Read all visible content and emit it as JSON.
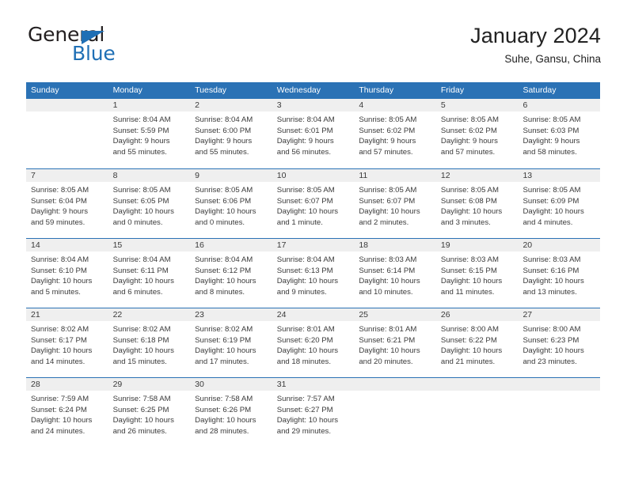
{
  "brand": {
    "name_top": "General",
    "name_bottom": "Blue",
    "triangle_color": "#1f6fb5",
    "top_color": "#231f20"
  },
  "header": {
    "title": "January 2024",
    "subtitle": "Suhe, Gansu, China"
  },
  "colors": {
    "header_bar": "#2b72b5",
    "day_strip": "#efefef",
    "text": "#3a3a3a",
    "header_text": "#ffffff"
  },
  "weekdays": [
    "Sunday",
    "Monday",
    "Tuesday",
    "Wednesday",
    "Thursday",
    "Friday",
    "Saturday"
  ],
  "weeks": [
    [
      {
        "day": "",
        "empty": true
      },
      {
        "day": "1",
        "sunrise": "Sunrise: 8:04 AM",
        "sunset": "Sunset: 5:59 PM",
        "daylight1": "Daylight: 9 hours",
        "daylight2": "and 55 minutes."
      },
      {
        "day": "2",
        "sunrise": "Sunrise: 8:04 AM",
        "sunset": "Sunset: 6:00 PM",
        "daylight1": "Daylight: 9 hours",
        "daylight2": "and 55 minutes."
      },
      {
        "day": "3",
        "sunrise": "Sunrise: 8:04 AM",
        "sunset": "Sunset: 6:01 PM",
        "daylight1": "Daylight: 9 hours",
        "daylight2": "and 56 minutes."
      },
      {
        "day": "4",
        "sunrise": "Sunrise: 8:05 AM",
        "sunset": "Sunset: 6:02 PM",
        "daylight1": "Daylight: 9 hours",
        "daylight2": "and 57 minutes."
      },
      {
        "day": "5",
        "sunrise": "Sunrise: 8:05 AM",
        "sunset": "Sunset: 6:02 PM",
        "daylight1": "Daylight: 9 hours",
        "daylight2": "and 57 minutes."
      },
      {
        "day": "6",
        "sunrise": "Sunrise: 8:05 AM",
        "sunset": "Sunset: 6:03 PM",
        "daylight1": "Daylight: 9 hours",
        "daylight2": "and 58 minutes."
      }
    ],
    [
      {
        "day": "7",
        "sunrise": "Sunrise: 8:05 AM",
        "sunset": "Sunset: 6:04 PM",
        "daylight1": "Daylight: 9 hours",
        "daylight2": "and 59 minutes."
      },
      {
        "day": "8",
        "sunrise": "Sunrise: 8:05 AM",
        "sunset": "Sunset: 6:05 PM",
        "daylight1": "Daylight: 10 hours",
        "daylight2": "and 0 minutes."
      },
      {
        "day": "9",
        "sunrise": "Sunrise: 8:05 AM",
        "sunset": "Sunset: 6:06 PM",
        "daylight1": "Daylight: 10 hours",
        "daylight2": "and 0 minutes."
      },
      {
        "day": "10",
        "sunrise": "Sunrise: 8:05 AM",
        "sunset": "Sunset: 6:07 PM",
        "daylight1": "Daylight: 10 hours",
        "daylight2": "and 1 minute."
      },
      {
        "day": "11",
        "sunrise": "Sunrise: 8:05 AM",
        "sunset": "Sunset: 6:07 PM",
        "daylight1": "Daylight: 10 hours",
        "daylight2": "and 2 minutes."
      },
      {
        "day": "12",
        "sunrise": "Sunrise: 8:05 AM",
        "sunset": "Sunset: 6:08 PM",
        "daylight1": "Daylight: 10 hours",
        "daylight2": "and 3 minutes."
      },
      {
        "day": "13",
        "sunrise": "Sunrise: 8:05 AM",
        "sunset": "Sunset: 6:09 PM",
        "daylight1": "Daylight: 10 hours",
        "daylight2": "and 4 minutes."
      }
    ],
    [
      {
        "day": "14",
        "sunrise": "Sunrise: 8:04 AM",
        "sunset": "Sunset: 6:10 PM",
        "daylight1": "Daylight: 10 hours",
        "daylight2": "and 5 minutes."
      },
      {
        "day": "15",
        "sunrise": "Sunrise: 8:04 AM",
        "sunset": "Sunset: 6:11 PM",
        "daylight1": "Daylight: 10 hours",
        "daylight2": "and 6 minutes."
      },
      {
        "day": "16",
        "sunrise": "Sunrise: 8:04 AM",
        "sunset": "Sunset: 6:12 PM",
        "daylight1": "Daylight: 10 hours",
        "daylight2": "and 8 minutes."
      },
      {
        "day": "17",
        "sunrise": "Sunrise: 8:04 AM",
        "sunset": "Sunset: 6:13 PM",
        "daylight1": "Daylight: 10 hours",
        "daylight2": "and 9 minutes."
      },
      {
        "day": "18",
        "sunrise": "Sunrise: 8:03 AM",
        "sunset": "Sunset: 6:14 PM",
        "daylight1": "Daylight: 10 hours",
        "daylight2": "and 10 minutes."
      },
      {
        "day": "19",
        "sunrise": "Sunrise: 8:03 AM",
        "sunset": "Sunset: 6:15 PM",
        "daylight1": "Daylight: 10 hours",
        "daylight2": "and 11 minutes."
      },
      {
        "day": "20",
        "sunrise": "Sunrise: 8:03 AM",
        "sunset": "Sunset: 6:16 PM",
        "daylight1": "Daylight: 10 hours",
        "daylight2": "and 13 minutes."
      }
    ],
    [
      {
        "day": "21",
        "sunrise": "Sunrise: 8:02 AM",
        "sunset": "Sunset: 6:17 PM",
        "daylight1": "Daylight: 10 hours",
        "daylight2": "and 14 minutes."
      },
      {
        "day": "22",
        "sunrise": "Sunrise: 8:02 AM",
        "sunset": "Sunset: 6:18 PM",
        "daylight1": "Daylight: 10 hours",
        "daylight2": "and 15 minutes."
      },
      {
        "day": "23",
        "sunrise": "Sunrise: 8:02 AM",
        "sunset": "Sunset: 6:19 PM",
        "daylight1": "Daylight: 10 hours",
        "daylight2": "and 17 minutes."
      },
      {
        "day": "24",
        "sunrise": "Sunrise: 8:01 AM",
        "sunset": "Sunset: 6:20 PM",
        "daylight1": "Daylight: 10 hours",
        "daylight2": "and 18 minutes."
      },
      {
        "day": "25",
        "sunrise": "Sunrise: 8:01 AM",
        "sunset": "Sunset: 6:21 PM",
        "daylight1": "Daylight: 10 hours",
        "daylight2": "and 20 minutes."
      },
      {
        "day": "26",
        "sunrise": "Sunrise: 8:00 AM",
        "sunset": "Sunset: 6:22 PM",
        "daylight1": "Daylight: 10 hours",
        "daylight2": "and 21 minutes."
      },
      {
        "day": "27",
        "sunrise": "Sunrise: 8:00 AM",
        "sunset": "Sunset: 6:23 PM",
        "daylight1": "Daylight: 10 hours",
        "daylight2": "and 23 minutes."
      }
    ],
    [
      {
        "day": "28",
        "sunrise": "Sunrise: 7:59 AM",
        "sunset": "Sunset: 6:24 PM",
        "daylight1": "Daylight: 10 hours",
        "daylight2": "and 24 minutes."
      },
      {
        "day": "29",
        "sunrise": "Sunrise: 7:58 AM",
        "sunset": "Sunset: 6:25 PM",
        "daylight1": "Daylight: 10 hours",
        "daylight2": "and 26 minutes."
      },
      {
        "day": "30",
        "sunrise": "Sunrise: 7:58 AM",
        "sunset": "Sunset: 6:26 PM",
        "daylight1": "Daylight: 10 hours",
        "daylight2": "and 28 minutes."
      },
      {
        "day": "31",
        "sunrise": "Sunrise: 7:57 AM",
        "sunset": "Sunset: 6:27 PM",
        "daylight1": "Daylight: 10 hours",
        "daylight2": "and 29 minutes."
      },
      {
        "day": "",
        "empty": true
      },
      {
        "day": "",
        "empty": true
      },
      {
        "day": "",
        "empty": true
      }
    ]
  ]
}
